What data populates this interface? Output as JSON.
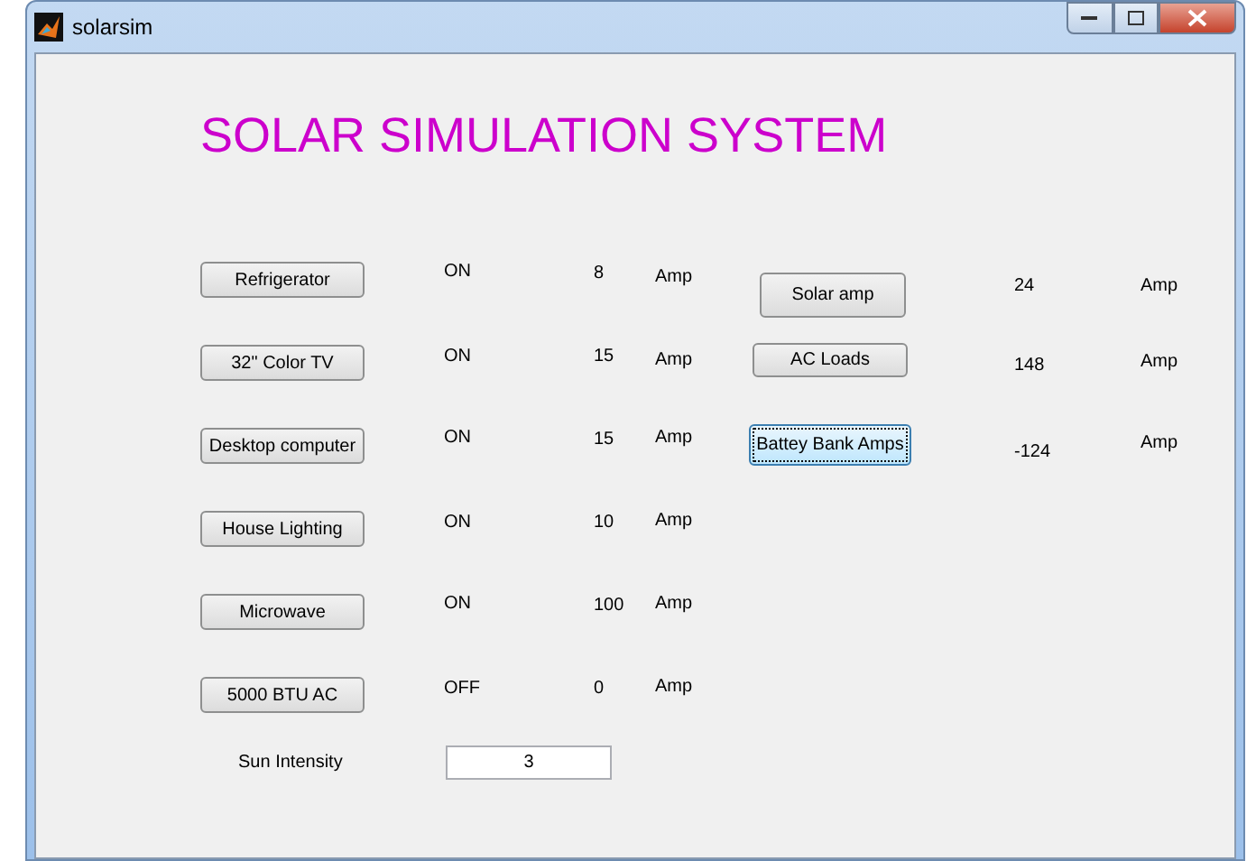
{
  "window": {
    "title": "solarsim"
  },
  "heading": "SOLAR SIMULATION SYSTEM",
  "appliances": [
    {
      "name": "Refrigerator",
      "status": "ON",
      "amps": "8",
      "unit": "Amp"
    },
    {
      "name": "32\" Color TV",
      "status": "ON",
      "amps": "15",
      "unit": "Amp"
    },
    {
      "name": "Desktop computer",
      "status": "ON",
      "amps": "15",
      "unit": "Amp"
    },
    {
      "name": "House Lighting",
      "status": "ON",
      "amps": "10",
      "unit": "Amp"
    },
    {
      "name": "Microwave",
      "status": "ON",
      "amps": "100",
      "unit": "Amp"
    },
    {
      "name": "5000 BTU AC",
      "status": "OFF",
      "amps": "0",
      "unit": "Amp"
    }
  ],
  "summary": [
    {
      "name": "Solar amp",
      "value": "24",
      "unit": "Amp",
      "focused": false
    },
    {
      "name": "AC Loads",
      "value": "148",
      "unit": "Amp",
      "focused": false
    },
    {
      "name": "Battey Bank Amps",
      "value": "-124",
      "unit": "Amp",
      "focused": true
    }
  ],
  "sun_intensity": {
    "label": "Sun Intensity",
    "value": "3"
  }
}
